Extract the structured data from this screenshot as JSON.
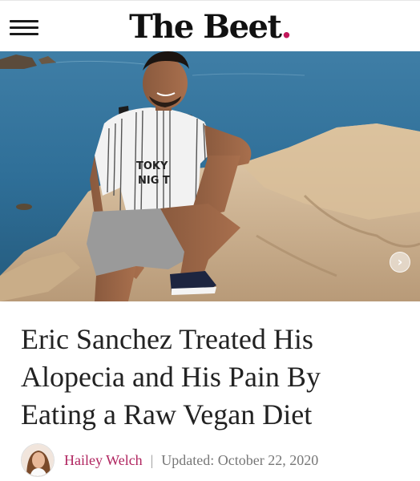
{
  "header": {
    "logo_text": "The Beet",
    "logo_dot": ".",
    "menu_icon": "hamburger-menu-icon",
    "accent_color": "#c2185b"
  },
  "hero": {
    "shirt_text_line1": "TOKY",
    "shirt_text_line2": "NIG T",
    "next_icon": "chevron-right-icon"
  },
  "article": {
    "title": "Eric Sanchez Treated His Alopecia and His Pain By Eating a Raw Vegan Diet",
    "author": "Hailey Welch",
    "separator": "|",
    "updated": "Updated: October 22, 2020"
  }
}
